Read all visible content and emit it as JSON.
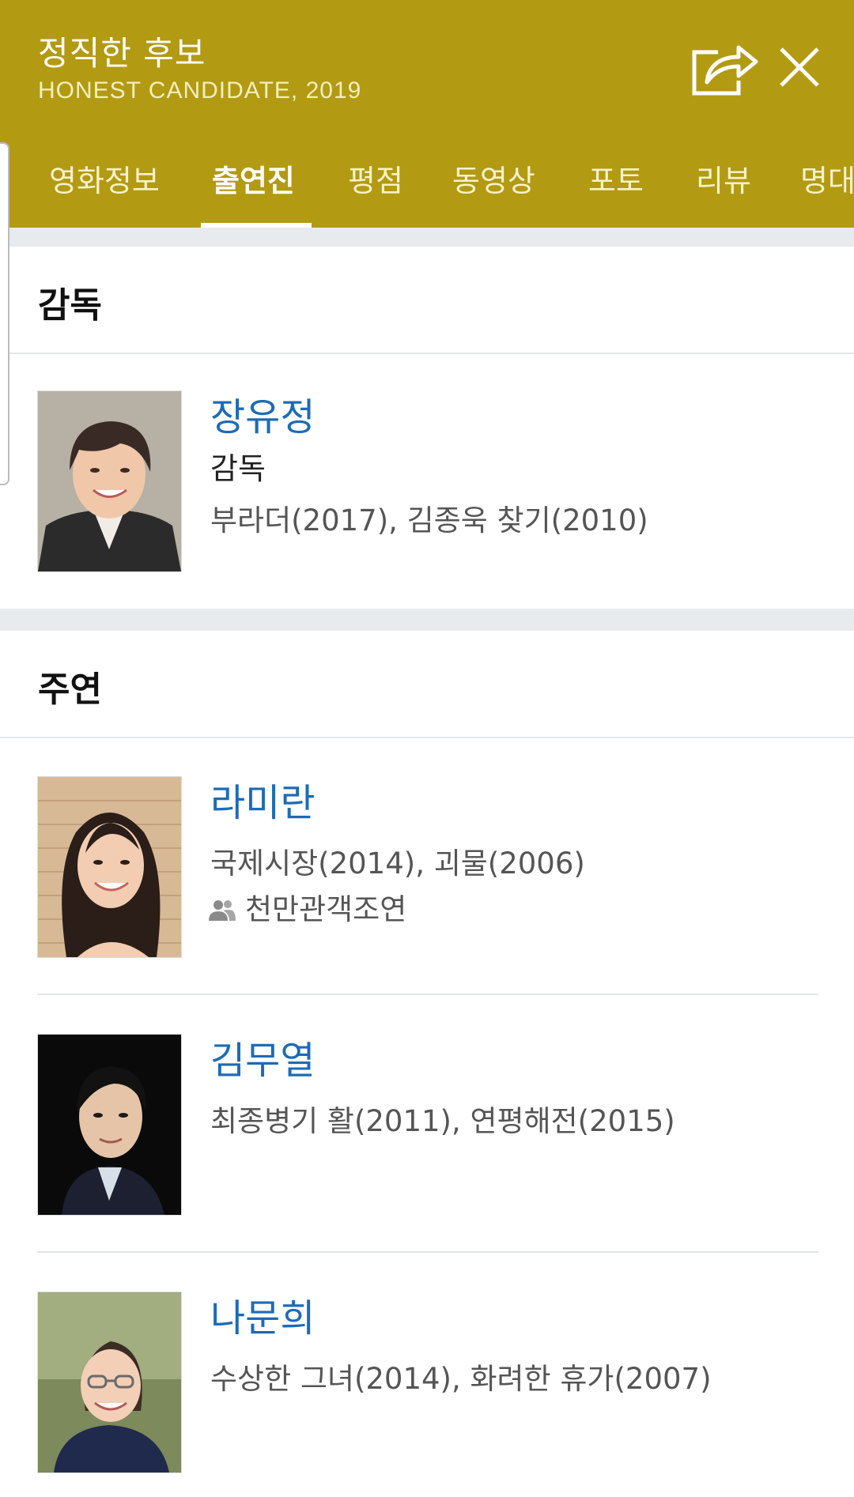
{
  "colors": {
    "accent": "#b29a13",
    "accent_dark": "#b29a13",
    "link": "#1d6bb6"
  },
  "header": {
    "title": "정직한 후보",
    "subtitle": "HONEST CANDIDATE, 2019",
    "share_icon": "share-icon",
    "close_icon": "close-icon"
  },
  "tabs": [
    {
      "label": "영화정보"
    },
    {
      "label": "출연진"
    },
    {
      "label": "평점"
    },
    {
      "label": "동영상"
    },
    {
      "label": "포토"
    },
    {
      "label": "리뷰"
    },
    {
      "label": "명대사"
    }
  ],
  "active_tab": "출연진",
  "director_section": {
    "title": "감독",
    "person": {
      "name": "장유정",
      "role": "감독",
      "works": "부라더(2017), 김종욱 찾기(2010)"
    }
  },
  "lead_section": {
    "title": "주연",
    "people": [
      {
        "name": "라미란",
        "works": "국제시장(2014), 괴물(2006)",
        "badge": "천만관객조연",
        "badge_icon": "people-icon"
      },
      {
        "name": "김무열",
        "works": "최종병기 활(2011), 연평해전(2015)"
      },
      {
        "name": "나문희",
        "works": "수상한 그녀(2014), 화려한 휴가(2007)"
      }
    ]
  }
}
